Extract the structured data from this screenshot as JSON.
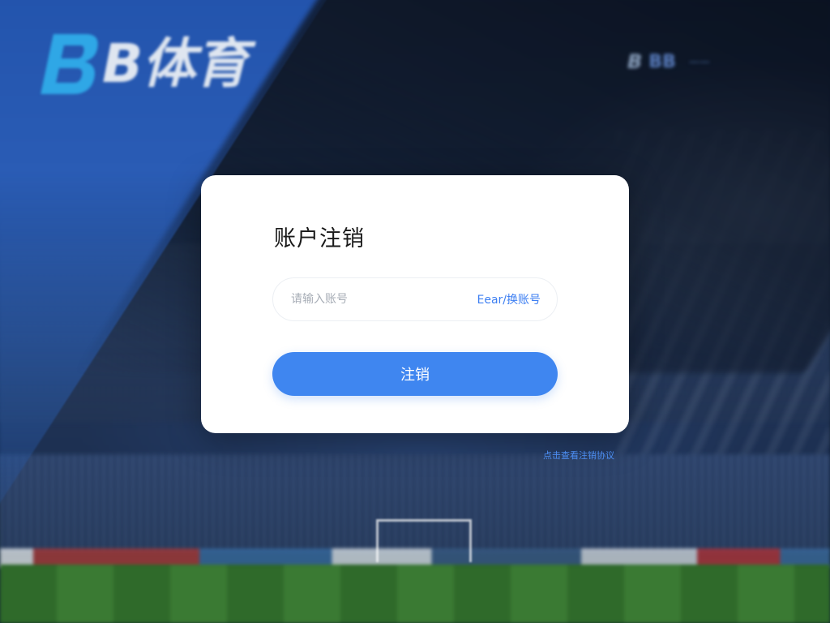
{
  "brand": {
    "logo_text": "B体育",
    "mark_icon": "bb-logo-icon",
    "accent_color": "#2fa7e6"
  },
  "header": {
    "mini_logo": "B",
    "item": "BB",
    "line": "——"
  },
  "dialog": {
    "title": "账户注销",
    "account_placeholder": "请输入账号",
    "switch_label": "Eear/换账号",
    "submit_label": "注销"
  },
  "footer_link": "点击查看注销协议",
  "colors": {
    "primary": "#3f86f0",
    "link": "#3d7ff2",
    "card": "#ffffff",
    "title": "#1a1a1a"
  }
}
